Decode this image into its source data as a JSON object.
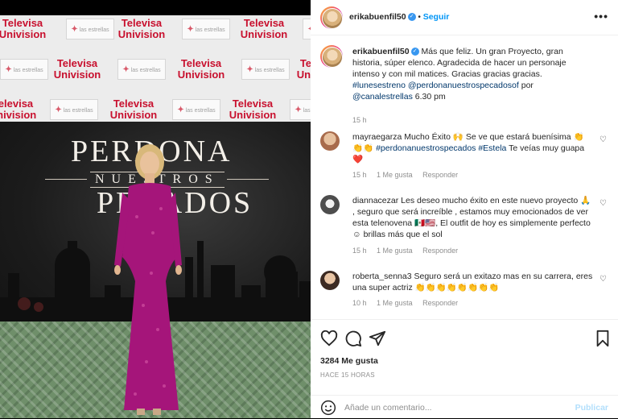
{
  "post": {
    "author": "erikabuenfil50",
    "follow_label": "Seguir",
    "separator": "•",
    "more_label": "•••",
    "caption_author": "erikabuenfil50",
    "caption_text": "Más que feliz. Un gran Proyecto, gran historia, súper elenco. Agradecida de hacer un personaje intenso y con mil matices. Gracias gracias gracias.",
    "caption_tags": "#lunesestreno @perdonanuestrospecadosof",
    "caption_by": "por",
    "caption_channel": "@canalestrellas",
    "caption_time": "6.30 pm",
    "caption_age": "15 h"
  },
  "photo": {
    "brand": "Televisa Univision",
    "brand_line1": "Televisa",
    "brand_line2": "Univision",
    "estrellas": "las estrellas",
    "title_line1": "PERDONA",
    "title_line2": "NUESTROS",
    "title_line3": "PECADOS"
  },
  "comments": [
    {
      "user": "mayraegarza",
      "text": "Mucho Éxito 🙌 Se ve que estará buenísima 👏👏👏",
      "tags": "#perdonanuestrospecados #Estela",
      "tail": "Te veías muy guapa ❤️",
      "age": "15 h",
      "likes": "1 Me gusta",
      "reply": "Responder"
    },
    {
      "user": "diannacezar",
      "text": "Les deseo mucho éxito en este nuevo proyecto 🙏 , seguro que será increíble , estamos muy emocionados de ver esta telenovena 🇲🇽🇺🇸, El outfit de hoy es simplemente perfecto ☺ brillas más que el sol",
      "age": "15 h",
      "likes": "1 Me gusta",
      "reply": "Responder"
    },
    {
      "user": "roberta_senna3",
      "text": "Seguro será un exitazo mas en su carrera, eres una super actriz 👏👏👏👏👏👏👏👏",
      "age": "10 h",
      "likes": "1 Me gusta",
      "reply": "Responder"
    }
  ],
  "actions": {
    "likes": "3284 Me gusta",
    "ago": "HACE 15 HORAS",
    "comment_placeholder": "Añade un comentario...",
    "publish": "Publicar"
  }
}
